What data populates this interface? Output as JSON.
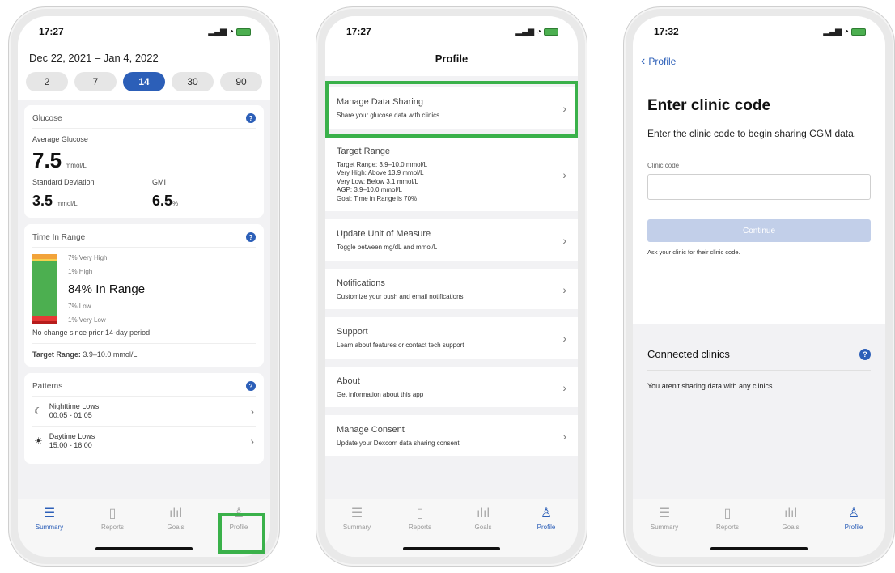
{
  "status": {
    "time1": "17:27",
    "time2": "17:27",
    "time3": "17:32"
  },
  "tabs": [
    {
      "label": "Summary",
      "icon": "list-icon"
    },
    {
      "label": "Reports",
      "icon": "document-icon"
    },
    {
      "label": "Goals",
      "icon": "bar-chart-icon"
    },
    {
      "label": "Profile",
      "icon": "person-icon"
    }
  ],
  "summary": {
    "date_range": "Dec 22, 2021 – Jan 4, 2022",
    "periods": [
      "2",
      "7",
      "14",
      "30",
      "90"
    ],
    "selected_period": "14",
    "glucose": {
      "title": "Glucose",
      "avg_label": "Average Glucose",
      "avg_value": "7.5",
      "avg_unit": "mmol/L",
      "sd_label": "Standard Deviation",
      "sd_value": "3.5",
      "sd_unit": "mmol/L",
      "gmi_label": "GMI",
      "gmi_value": "6.5",
      "gmi_unit": "%"
    },
    "tir": {
      "title": "Time In Range",
      "very_high": "7% Very High",
      "high": "1% High",
      "in_range": "84% In Range",
      "low": "7% Low",
      "very_low": "1% Very Low",
      "segments": [
        {
          "name": "very-high",
          "pct": 7,
          "color": "#f2a33a"
        },
        {
          "name": "high",
          "pct": 1,
          "color": "#f6d04d"
        },
        {
          "name": "in-range",
          "pct": 84,
          "color": "#4caf50"
        },
        {
          "name": "low",
          "pct": 7,
          "color": "#e53935"
        },
        {
          "name": "very-low",
          "pct": 1,
          "color": "#b71c1c"
        }
      ],
      "change_note": "No change since prior 14-day period",
      "target_label": "Target Range:",
      "target_value": "3.9–10.0 mmol/L"
    },
    "patterns": {
      "title": "Patterns",
      "items": [
        {
          "title": "Nighttime Lows",
          "time": "00:05 - 01:05",
          "icon": "moon-icon"
        },
        {
          "title": "Daytime Lows",
          "time": "15:00 - 16:00",
          "icon": "sun-icon"
        }
      ]
    }
  },
  "profile": {
    "title": "Profile",
    "items": [
      {
        "title": "Manage Data Sharing",
        "desc": "Share your glucose data with clinics"
      },
      {
        "title": "Target Range",
        "desc": "Target Range: 3.9–10.0 mmol/L\nVery High: Above 13.9 mmol/L\nVery Low: Below 3.1 mmol/L\nAGP: 3.9–10.0 mmol/L\nGoal: Time in Range is 70%"
      },
      {
        "title": "Update Unit of Measure",
        "desc": "Toggle between mg/dL and mmol/L"
      },
      {
        "title": "Notifications",
        "desc": "Customize your push and email notifications"
      },
      {
        "title": "Support",
        "desc": "Learn about features or contact tech support"
      },
      {
        "title": "About",
        "desc": "Get information about this app"
      },
      {
        "title": "Manage Consent",
        "desc": "Update your Dexcom data sharing consent"
      }
    ]
  },
  "clinic": {
    "back_label": "Profile",
    "heading": "Enter clinic code",
    "description": "Enter the clinic code to begin sharing CGM data.",
    "field_label": "Clinic code",
    "field_value": "",
    "continue_label": "Continue",
    "hint": "Ask your clinic for their clinic code.",
    "connected_title": "Connected clinics",
    "connected_empty": "You aren't sharing data with any clinics."
  },
  "colors": {
    "accent": "#2c5fb8",
    "highlight": "#3ab14a"
  }
}
